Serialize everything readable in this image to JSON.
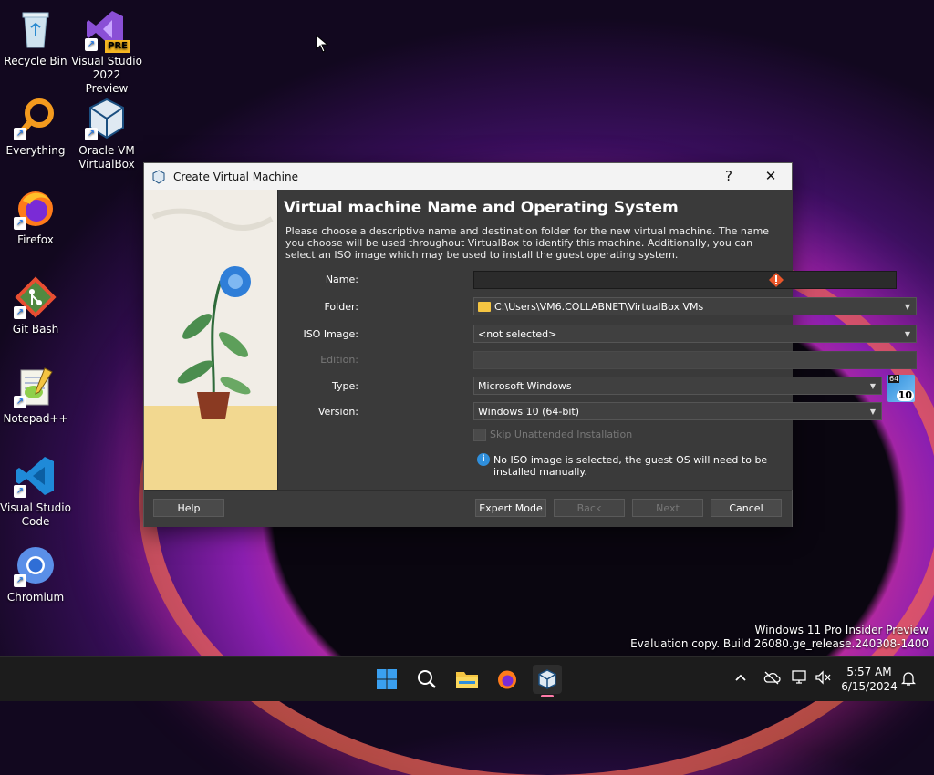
{
  "desktop": {
    "icons": [
      {
        "label": "Recycle Bin",
        "icon": "recycle-bin-icon"
      },
      {
        "label": "Visual Studio 2022 Preview",
        "icon": "visual-studio-icon",
        "badge": "PRE"
      },
      {
        "label": "Everything",
        "icon": "everything-search-icon"
      },
      {
        "label": "Oracle VM VirtualBox",
        "icon": "virtualbox-icon"
      },
      {
        "label": "Firefox",
        "icon": "firefox-icon"
      },
      {
        "label": "Git Bash",
        "icon": "git-bash-icon"
      },
      {
        "label": "Notepad++",
        "icon": "notepadpp-icon"
      },
      {
        "label": "Visual Studio Code",
        "icon": "vscode-icon"
      },
      {
        "label": "Chromium",
        "icon": "chromium-icon"
      }
    ]
  },
  "dialog": {
    "title": "Create Virtual Machine",
    "help_glyph": "?",
    "close_glyph": "✕",
    "heading": "Virtual machine Name and Operating System",
    "description": "Please choose a descriptive name and destination folder for the new virtual machine. The name you choose will be used throughout VirtualBox to identify this machine. Additionally, you can select an ISO image which may be used to install the guest operating system.",
    "fields": {
      "name_label": "Name:",
      "name_value": "",
      "folder_label": "Folder:",
      "folder_value": "C:\\Users\\VM6.COLLABNET\\VirtualBox VMs",
      "iso_label": "ISO Image:",
      "iso_value": "<not selected>",
      "edition_label": "Edition:",
      "edition_value": "",
      "type_label": "Type:",
      "type_value": "Microsoft Windows",
      "version_label": "Version:",
      "version_value": "Windows 10 (64-bit)",
      "skip_unattended_label": "Skip Unattended Installation",
      "skip_unattended_checked": false,
      "os_badge_top": "64",
      "os_badge_bottom": "10"
    },
    "info_text": "No ISO image is selected, the guest OS will need to be installed manually.",
    "buttons": {
      "help": "Help",
      "expert_mode": "Expert Mode",
      "back": "Back",
      "next": "Next",
      "cancel": "Cancel"
    }
  },
  "watermark": {
    "line1": "Windows 11 Pro Insider Preview",
    "line2": "Evaluation copy. Build 26080.ge_release.240308-1400"
  },
  "taskbar": {
    "apps": [
      "start-icon",
      "search-icon",
      "file-explorer-icon",
      "firefox-icon",
      "virtualbox-icon"
    ],
    "time": "5:57 AM",
    "date": "6/15/2024"
  },
  "colors": {
    "dialog_bg": "#3a3a3a",
    "titlebar_bg": "#f3f3f3",
    "taskbar_bg": "#1c1c1c",
    "warning": "#e8562a",
    "info": "#2f8fdc"
  }
}
